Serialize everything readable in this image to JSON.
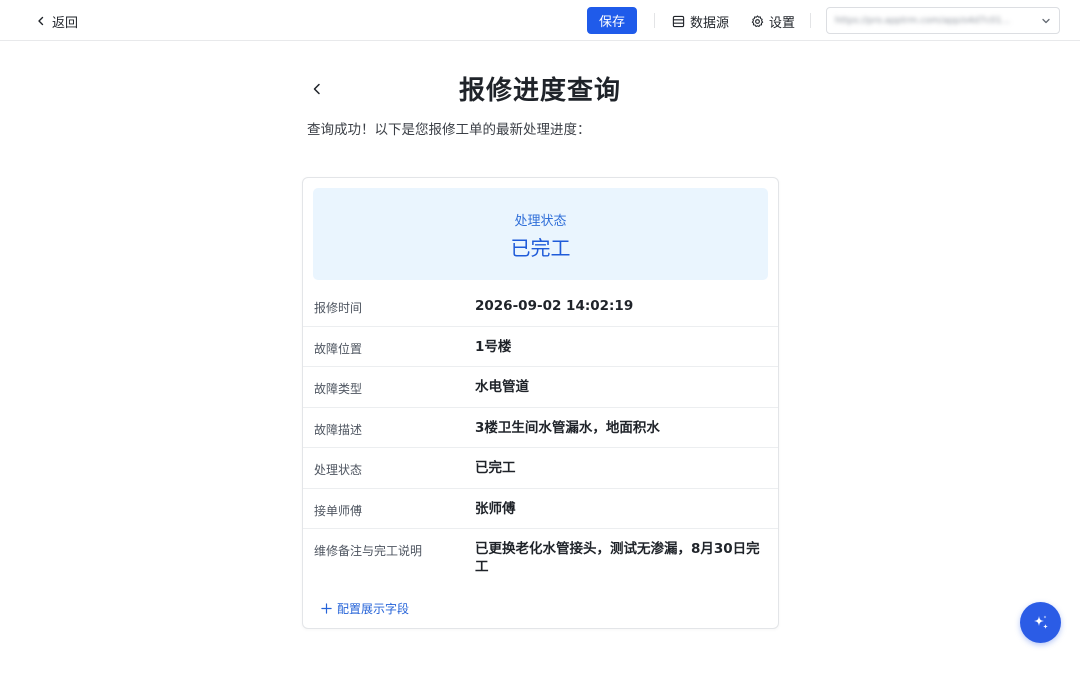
{
  "topbar": {
    "back_label": "返回",
    "save_label": "保存",
    "datasource_label": "数据源",
    "settings_label": "设置",
    "url_value": "https://pro.apptrm.com/app/o4d7c01..."
  },
  "page": {
    "title": "报修进度查询",
    "subtitle": "查询成功！以下是您报修工单的最新处理进度："
  },
  "status_banner": {
    "label": "处理状态",
    "value": "已完工"
  },
  "rows": [
    {
      "label": "报修时间",
      "value": "2026-09-02 14:02:19"
    },
    {
      "label": "故障位置",
      "value": "1号楼"
    },
    {
      "label": "故障类型",
      "value": "水电管道"
    },
    {
      "label": "故障描述",
      "value": "3楼卫生间水管漏水，地面积水"
    },
    {
      "label": "处理状态",
      "value": "已完工"
    },
    {
      "label": "接单师傅",
      "value": "张师傅"
    },
    {
      "label": "维修备注与完工说明",
      "value": "已更换老化水管接头，测试无渗漏，8月30日完工"
    }
  ],
  "config_link_label": "配置展示字段",
  "colors": {
    "primary": "#1f5bea",
    "banner_bg": "#eaf5fe",
    "status_text": "#1f5bd9"
  }
}
